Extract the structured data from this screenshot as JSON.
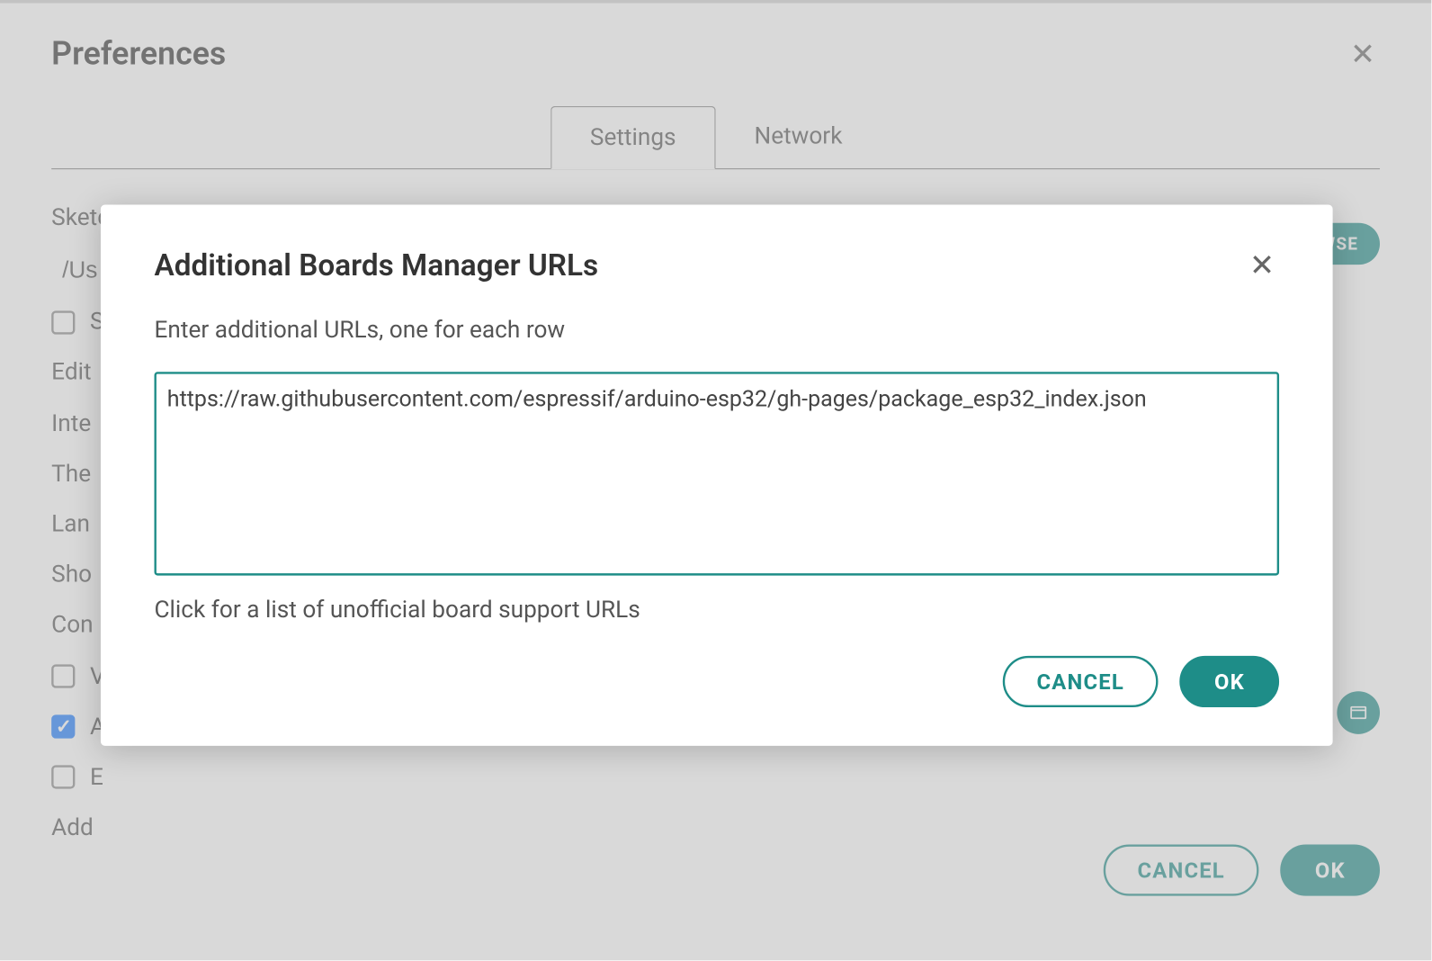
{
  "preferences": {
    "title": "Preferences",
    "tabs": {
      "settings": "Settings",
      "network": "Network"
    },
    "labels": {
      "sketchbook": "Sketchbook location:",
      "sketchbook_path": "/Us",
      "editor": "Edit",
      "interface": "Inte",
      "theme": "The",
      "language": "Lan",
      "show": "Sho",
      "compiler": "Con",
      "additional": "Add"
    },
    "browse": "BROWSE",
    "cancel": "CANCEL",
    "ok": "OK"
  },
  "modal": {
    "title": "Additional Boards Manager URLs",
    "instruction": "Enter additional URLs, one for each row",
    "textarea_value": "https://raw.githubusercontent.com/espressif/arduino-esp32/gh-pages/package_esp32_index.json",
    "link_text": "Click for a list of unofficial board support URLs",
    "cancel": "CANCEL",
    "ok": "OK"
  },
  "colors": {
    "teal": "#1e8d88"
  }
}
